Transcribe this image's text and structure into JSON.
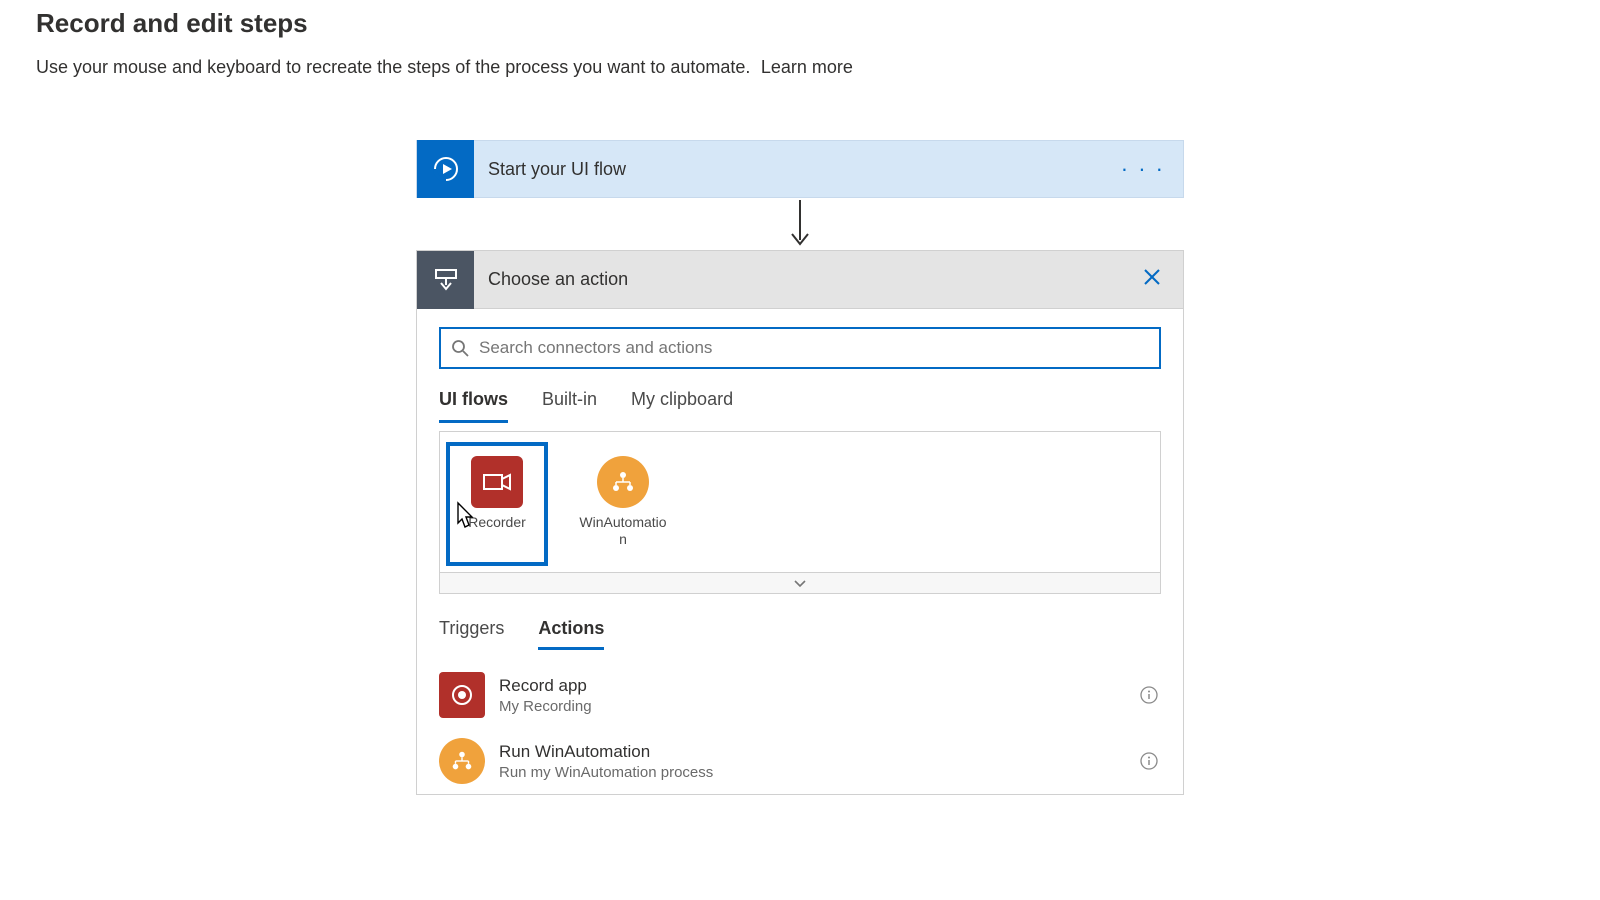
{
  "header": {
    "title": "Record and edit steps",
    "subtitle": "Use your mouse and keyboard to recreate the steps of the process you want to automate.",
    "learn_more": "Learn more"
  },
  "start_card": {
    "label": "Start your UI flow"
  },
  "chooser": {
    "title": "Choose an action",
    "search_placeholder": "Search connectors and actions"
  },
  "tabs": {
    "0": "UI flows",
    "1": "Built-in",
    "2": "My clipboard"
  },
  "connectors": {
    "0": "Recorder",
    "1": "WinAutomation"
  },
  "subtabs": {
    "0": "Triggers",
    "1": "Actions"
  },
  "actions": {
    "0": {
      "title": "Record app",
      "subtitle": "My Recording"
    },
    "1": {
      "title": "Run WinAutomation",
      "subtitle": "Run my WinAutomation process"
    }
  }
}
